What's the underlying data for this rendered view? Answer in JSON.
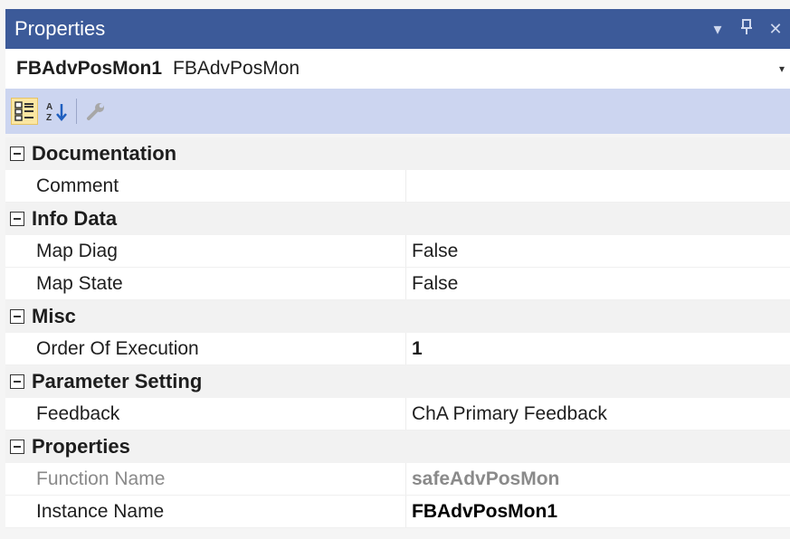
{
  "window": {
    "title": "Properties",
    "dropdown_glyph": "▾",
    "pin_glyph": "⊥",
    "close_glyph": "✕"
  },
  "selector": {
    "object_name": "FBAdvPosMon1",
    "object_type": "FBAdvPosMon",
    "dropdown_glyph": "▾"
  },
  "toolbar": {
    "tools": [
      "categorized-icon",
      "alphabetical-icon",
      "property-pages-icon"
    ]
  },
  "grid": {
    "categories": [
      {
        "label": "Documentation",
        "rows": [
          {
            "name": "Comment",
            "value": ""
          }
        ]
      },
      {
        "label": "Info Data",
        "rows": [
          {
            "name": "Map Diag",
            "value": "False"
          },
          {
            "name": "Map State",
            "value": "False"
          }
        ]
      },
      {
        "label": "Misc",
        "rows": [
          {
            "name": "Order Of Execution",
            "value": "1"
          }
        ]
      },
      {
        "label": "Parameter Setting",
        "rows": [
          {
            "name": "Feedback",
            "value": "ChA Primary Feedback"
          }
        ]
      },
      {
        "label": "Properties",
        "rows": [
          {
            "name": "Function Name",
            "value": "safeAdvPosMon"
          },
          {
            "name": "Instance Name",
            "value": "FBAdvPosMon1"
          }
        ]
      }
    ]
  },
  "colors": {
    "title_bar": "#3c5a99",
    "toolbar": "#ccd5f0",
    "active_tool": "#fbe6a2",
    "readonly_text": "#8a8a8a"
  }
}
